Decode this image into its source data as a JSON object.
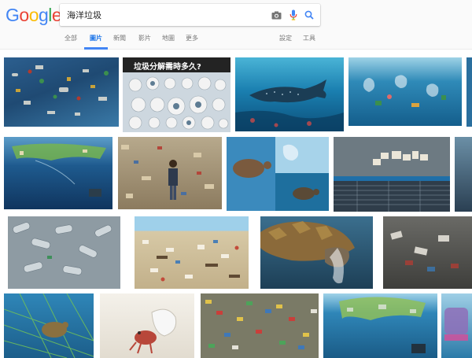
{
  "logo": {
    "letters": [
      "G",
      "o",
      "o",
      "g",
      "l",
      "e"
    ],
    "colors": [
      "#4285F4",
      "#EA4335",
      "#FBBC05",
      "#4285F4",
      "#34A853",
      "#EA4335"
    ]
  },
  "search": {
    "query": "海洋垃圾",
    "icons": [
      "camera-icon",
      "microphone-icon",
      "search-icon"
    ]
  },
  "tabs": [
    {
      "label": "全部"
    },
    {
      "label": "圖片",
      "active": true
    },
    {
      "label": "新聞"
    },
    {
      "label": "影片"
    },
    {
      "label": "地圖"
    },
    {
      "label": "更多"
    }
  ],
  "tools": {
    "settings": "設定",
    "tools": "工具"
  },
  "results": {
    "rows": [
      [
        {
          "name": "image-result-garbage-floating-blue-water"
        },
        {
          "name": "image-result-garbage-decomposition-infographic",
          "caption": "垃圾分解需時多久?"
        },
        {
          "name": "image-result-whale-shark-underwater"
        },
        {
          "name": "image-result-underwater-plastic-bags"
        }
      ],
      [
        {
          "name": "image-result-underwater-debris-surface"
        },
        {
          "name": "image-result-person-standing-in-garbage"
        },
        {
          "name": "image-result-turtle-collage"
        },
        {
          "name": "image-result-debris-table-chart"
        }
      ],
      [
        {
          "name": "image-result-plastic-bottles-pile"
        },
        {
          "name": "image-result-beach-covered-garbage"
        },
        {
          "name": "image-result-turtle-eating-plastic"
        },
        {
          "name": "image-result-trash-pile-closeup"
        }
      ],
      [
        {
          "name": "image-result-turtle-in-net"
        },
        {
          "name": "image-result-hermit-crab-plastic"
        },
        {
          "name": "image-result-colorful-trash-sea"
        },
        {
          "name": "image-result-underwater-garbage-clump"
        },
        {
          "name": "image-result-partial-edge"
        }
      ]
    ]
  }
}
